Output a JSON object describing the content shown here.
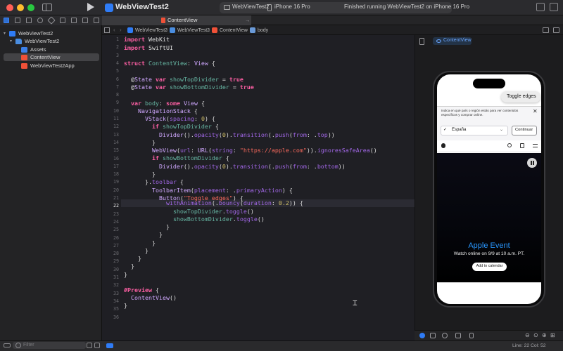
{
  "window": {
    "project_title": "WebViewTest2"
  },
  "toolbar": {
    "scheme_name": "WebViewTest2",
    "scheme_separator": "›",
    "device_name": "iPhone 16 Pro",
    "status": "Finished running WebViewTest2 on iPhone 16 Pro"
  },
  "editor_tab": {
    "label": "ContentView",
    "pin": "→"
  },
  "jumpbar": {
    "crumbs": [
      "WebViewTest2",
      "WebViewTest2",
      "ContentView",
      "body"
    ],
    "separator": "›"
  },
  "navigator": {
    "items": [
      {
        "label": "WebViewTest2",
        "disclosure": "▾"
      },
      {
        "label": "WebViewTest2",
        "disclosure": "▾"
      },
      {
        "label": "Assets"
      },
      {
        "label": "ContentView"
      },
      {
        "label": "WebViewTest2App"
      }
    ],
    "filter_placeholder": "Filter"
  },
  "code": {
    "line_numbers": [
      "1",
      "2",
      "3",
      "4",
      "5",
      "6",
      "7",
      "8",
      "9",
      "10",
      "11",
      "12",
      "13",
      "14",
      "15",
      "16",
      "17",
      "18",
      "19",
      "20",
      "21",
      "22",
      "23",
      "24",
      "25",
      "26",
      "27",
      "28",
      "29",
      "30",
      "31",
      "32",
      "33",
      "34",
      "35",
      "36"
    ],
    "current_line": 22
  },
  "status_bar": {
    "line": "Line: 22",
    "col": "Col: 52"
  },
  "canvas": {
    "preview_label": "ContentView",
    "toggle_button": "Toggle edges",
    "region_text": "Indica en qué país o región estás para ver contenidos específicos y comprar online.",
    "region_close": "✕",
    "region_check": "✓",
    "region_value": "España",
    "region_chevron": "⌄",
    "continue_label": "Continuar",
    "hero_title": "Apple Event",
    "hero_subtitle": "Watch online on 9/9 at 10 a.m. PT.",
    "calendar_label": "Add to calendar"
  },
  "colors": {
    "accent": "#2f7cf6",
    "swift_orange": "#f05138",
    "hero_blue": "#2997ff"
  }
}
